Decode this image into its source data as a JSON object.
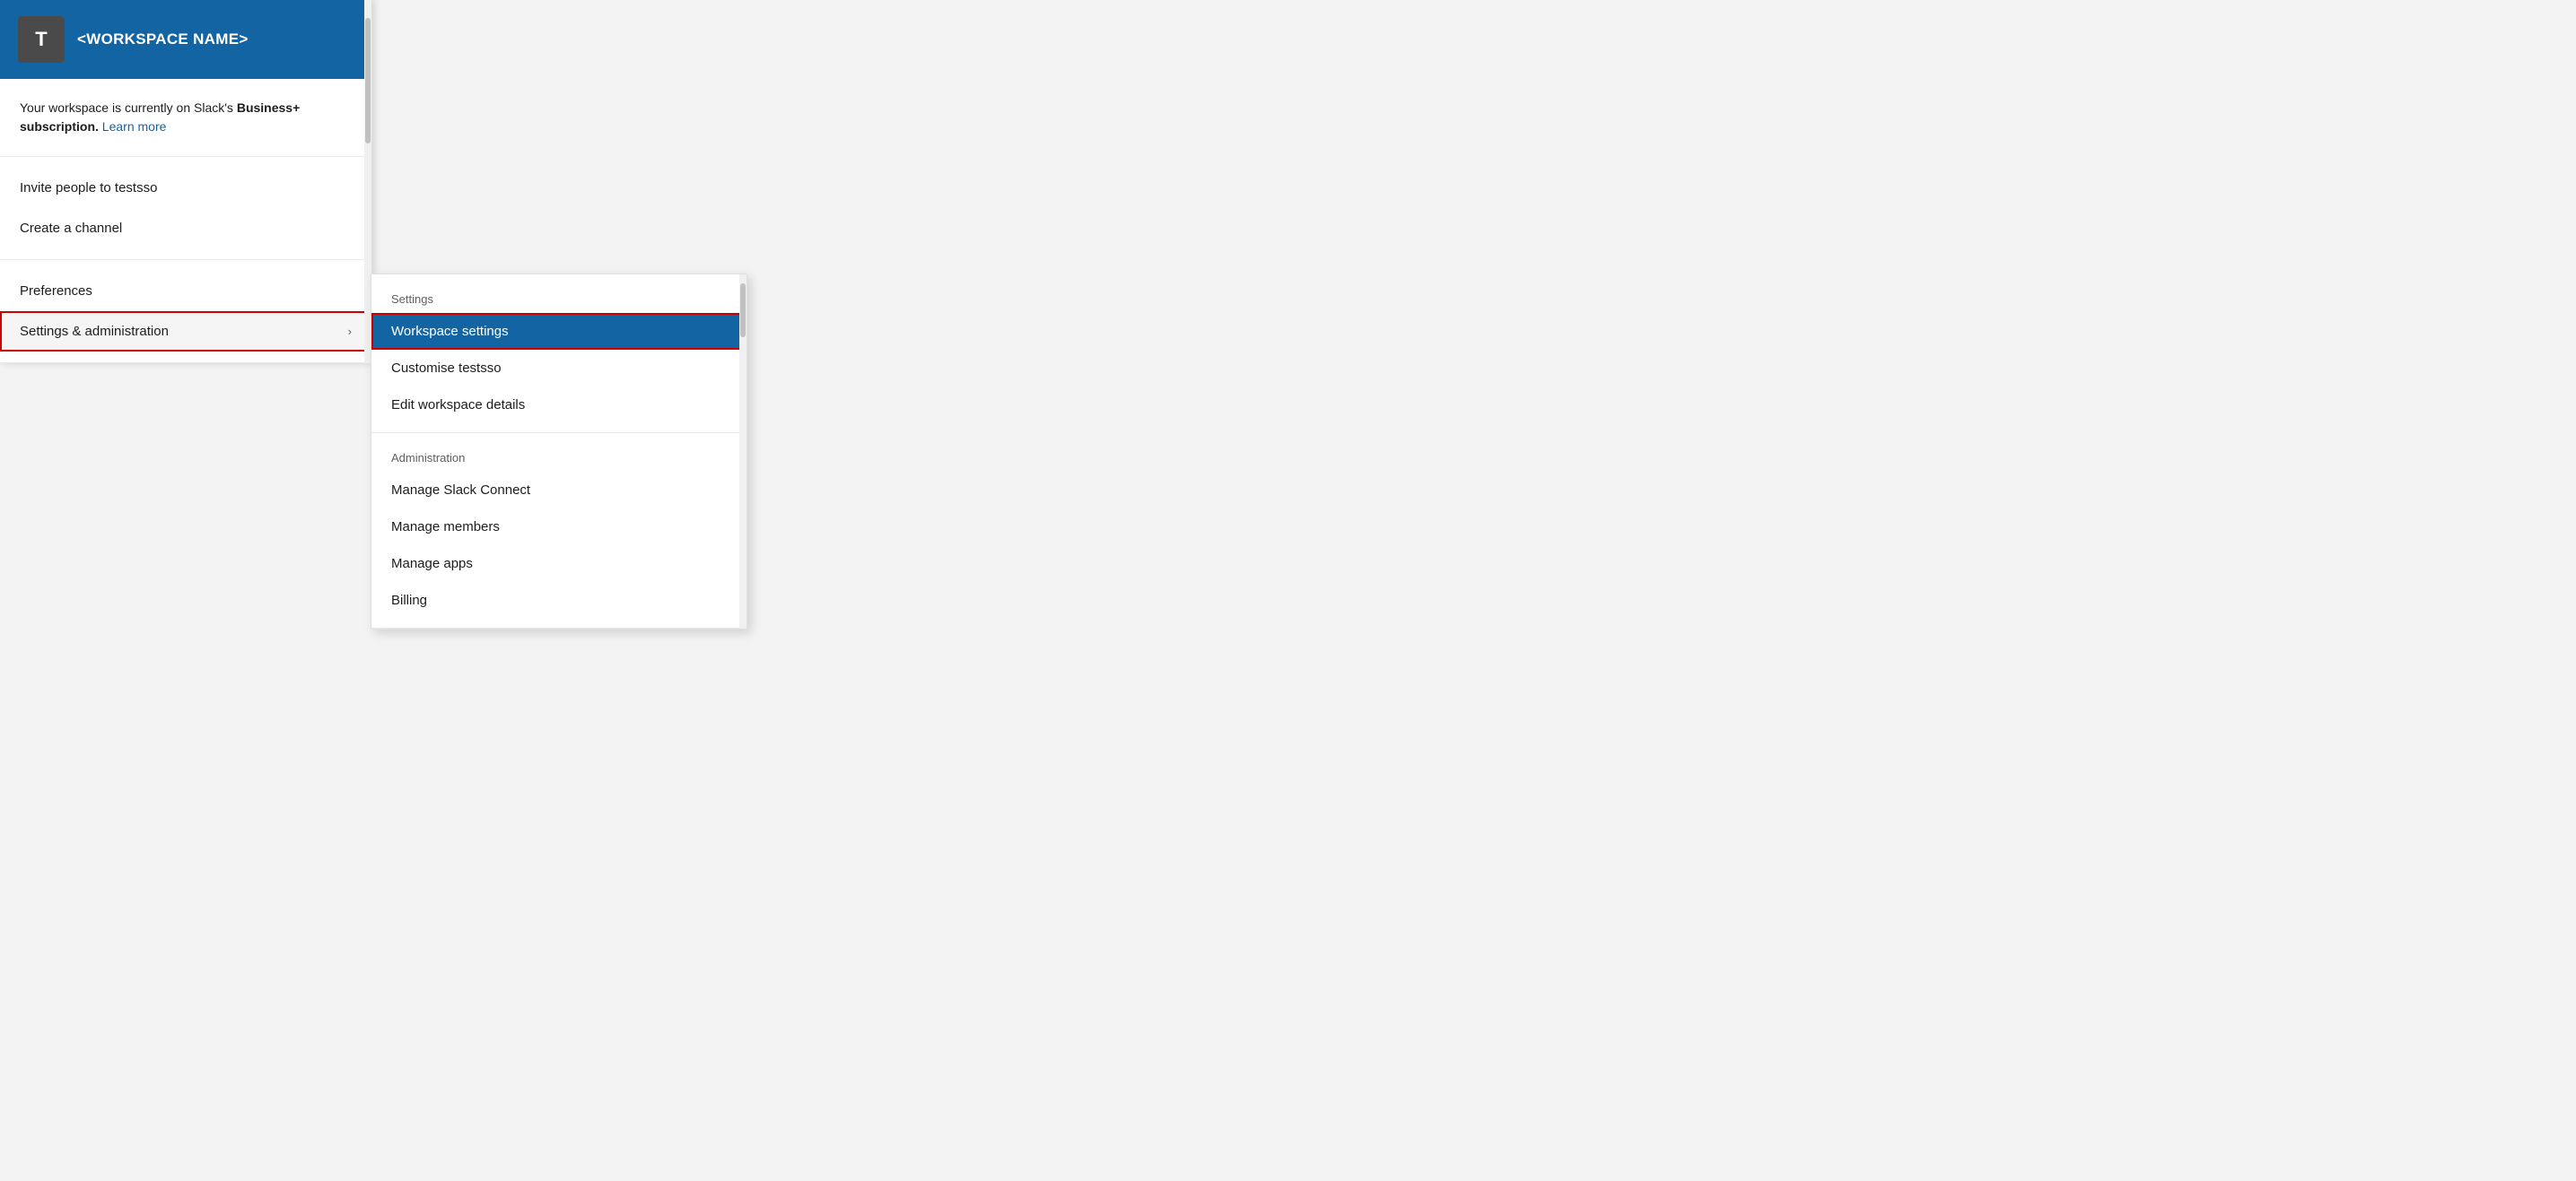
{
  "workspace": {
    "avatar_letter": "T",
    "name": "<WORKSPACE NAME>"
  },
  "subscription": {
    "text_before": "Your workspace is currently on Slack's ",
    "bold_text": "Business+ subscription.",
    "link_text": "Learn more"
  },
  "primary_menu": {
    "items": [
      {
        "label": "Invite people to testsso",
        "has_chevron": false
      },
      {
        "label": "Create a channel",
        "has_chevron": false
      }
    ],
    "items2": [
      {
        "label": "Preferences",
        "has_chevron": false
      },
      {
        "label": "Settings & administration",
        "has_chevron": true,
        "active": true
      }
    ]
  },
  "secondary_menu": {
    "settings_label": "Settings",
    "settings_items": [
      {
        "label": "Workspace settings",
        "selected": true
      },
      {
        "label": "Customise testsso",
        "selected": false
      },
      {
        "label": "Edit workspace details",
        "selected": false
      }
    ],
    "admin_label": "Administration",
    "admin_items": [
      {
        "label": "Manage Slack Connect"
      },
      {
        "label": "Manage members"
      },
      {
        "label": "Manage apps"
      },
      {
        "label": "Billing"
      }
    ]
  }
}
